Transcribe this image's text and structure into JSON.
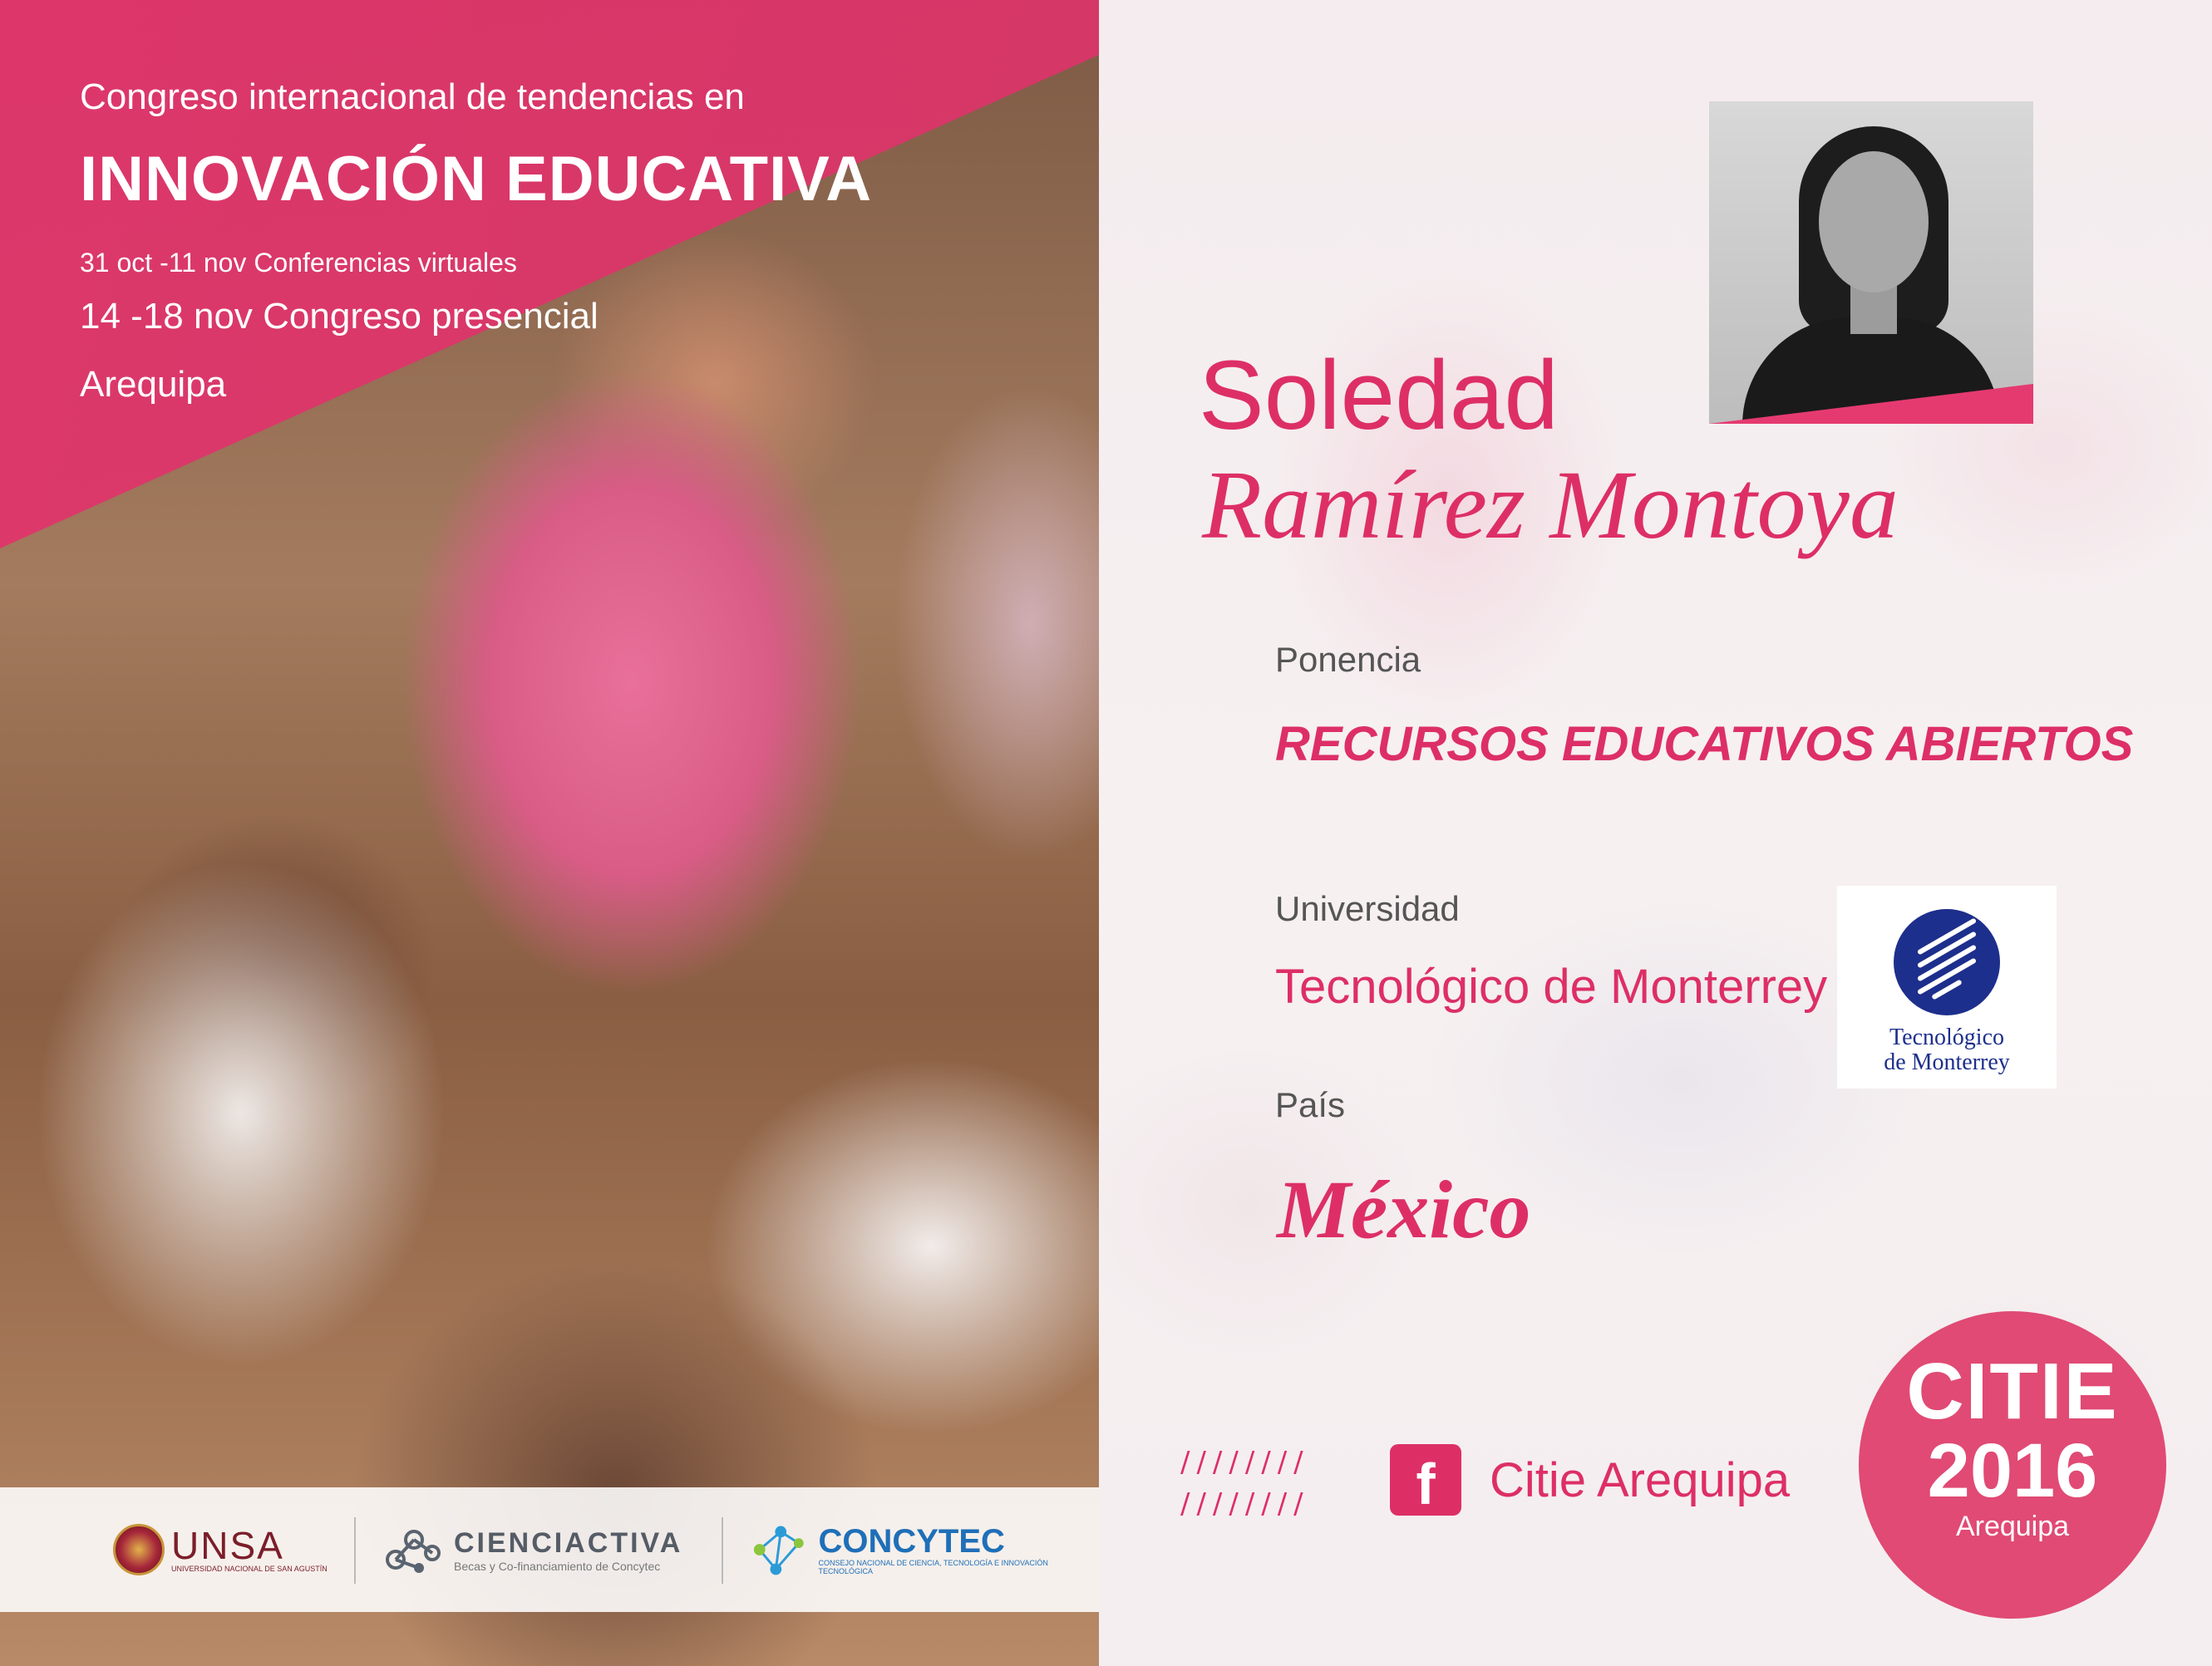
{
  "event": {
    "line1": "Congreso internacional de tendencias en",
    "title": "INNOVACIÓN EDUCATIVA",
    "virtual_dates": "31 oct -11 nov Conferencias virtuales",
    "inperson_dates": "14 -18 nov Congreso presencial",
    "city": "Arequipa"
  },
  "sponsors": {
    "unsa_name": "UNSA",
    "unsa_sub": "UNIVERSIDAD NACIONAL DE SAN AGUSTÍN",
    "cienciactiva_name": "CIENCIACTIVA",
    "cienciactiva_sub": "Becas y Co-financiamiento de Concytec",
    "concytec_name": "CONCYTEC",
    "concytec_sub": "CONSEJO NACIONAL DE CIENCIA, TECNOLOGÍA E INNOVACIÓN TECNOLÓGICA"
  },
  "speaker": {
    "first_name": "Soledad",
    "last_name": "Ramírez Montoya",
    "ponencia_label": "Ponencia",
    "ponencia_title": "RECURSOS EDUCATIVOS ABIERTOS",
    "university_label": "Universidad",
    "university": "Tecnológico de Monterrey",
    "country_label": "País",
    "country": "México"
  },
  "university_logo": {
    "line1": "Tecnológico",
    "line2": "de Monterrey"
  },
  "social": {
    "slashes_row1": "////////",
    "slashes_row2": "////////",
    "facebook_glyph": "f",
    "facebook_page": "Citie Arequipa"
  },
  "badge": {
    "name": "CITIE",
    "year": "2016",
    "city": "Arequipa"
  },
  "colors": {
    "brand_pink": "#dd2f66",
    "tec_blue": "#1d2f8c"
  }
}
